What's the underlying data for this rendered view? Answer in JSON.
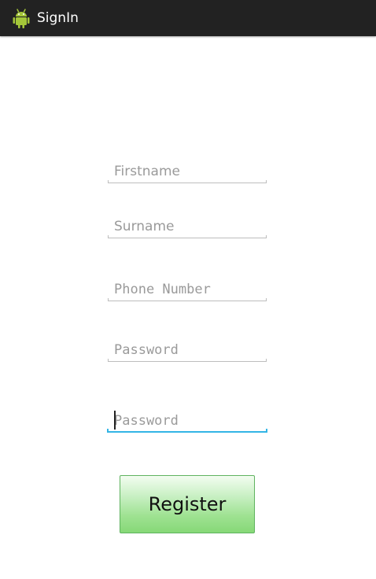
{
  "app": {
    "title": "SignIn",
    "icon": "android-robot-icon"
  },
  "form": {
    "firstname": {
      "placeholder": "Firstname",
      "value": ""
    },
    "surname": {
      "placeholder": "Surname",
      "value": ""
    },
    "phone": {
      "placeholder": "Phone Number",
      "value": ""
    },
    "password": {
      "placeholder": "Password",
      "value": ""
    },
    "confirm_password": {
      "placeholder": "Password",
      "value": "",
      "focused": true
    }
  },
  "register_label": "Register",
  "colors": {
    "action_bar": "#222222",
    "focus_accent": "#33b5e5",
    "button_green": "#9fe292",
    "android_green": "#a4c639"
  }
}
